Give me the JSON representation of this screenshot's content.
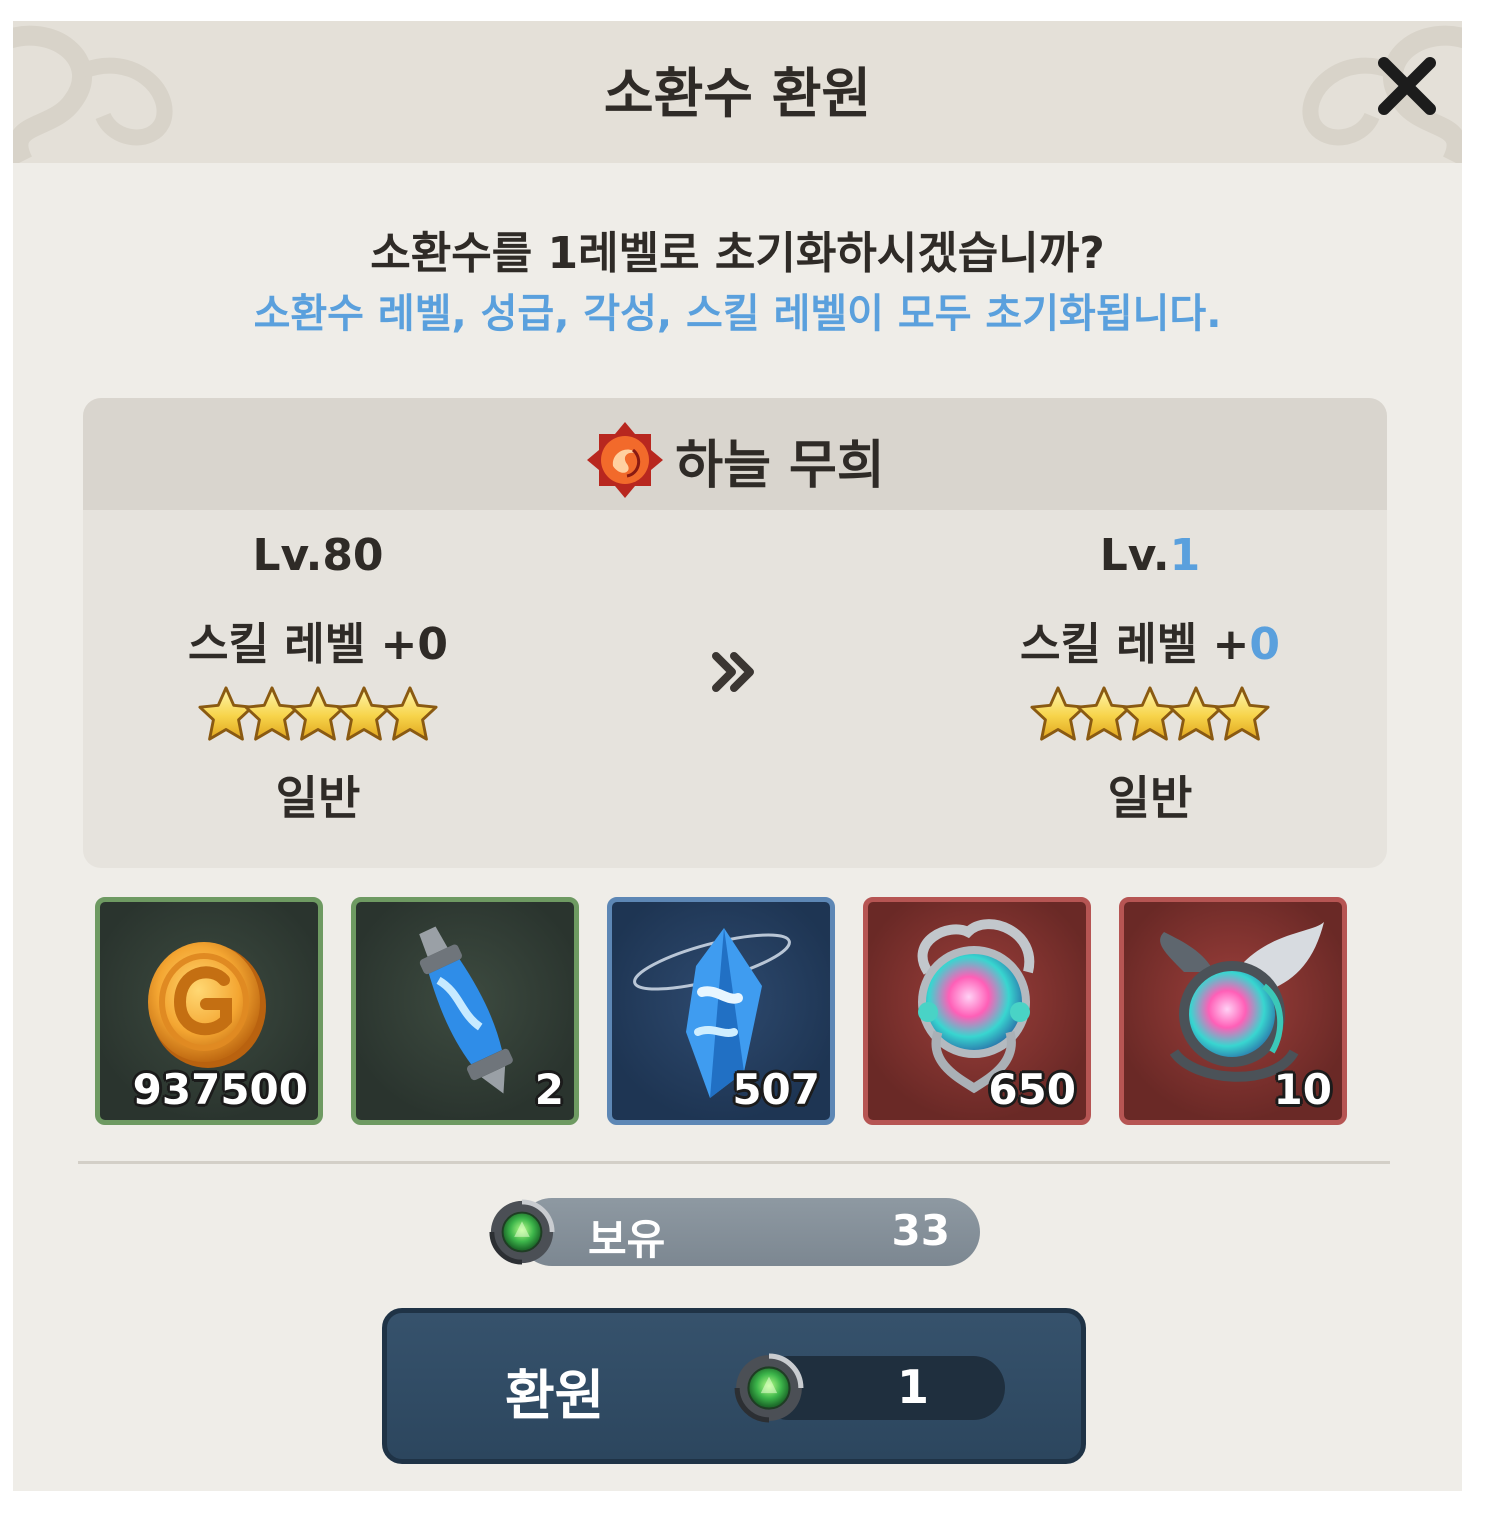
{
  "dialog": {
    "title": "소환수 환원",
    "question": "소환수를 1레벨로 초기화하시겠습니까?",
    "warning": "소환수 레벨, 성급, 각성, 스킬 레벨이 모두 초기화됩니다."
  },
  "summon": {
    "name": "하늘 무희",
    "element_icon": "fire-element-icon",
    "before": {
      "level_prefix": "Lv.",
      "level": "80",
      "skill_prefix": "스킬 레벨 +",
      "skill": "0",
      "stars": 5,
      "grade": "일반"
    },
    "after": {
      "level_prefix": "Lv.",
      "level": "1",
      "skill_prefix": "스킬 레벨 +",
      "skill": "0",
      "stars": 5,
      "grade": "일반"
    }
  },
  "rewards": [
    {
      "icon": "gold-coin-icon",
      "quantity": "937500",
      "rarity": "green"
    },
    {
      "icon": "blue-potion-vial-icon",
      "quantity": "2",
      "rarity": "green"
    },
    {
      "icon": "blue-crystal-icon",
      "quantity": "507",
      "rarity": "blue"
    },
    {
      "icon": "rainbow-orb-icon",
      "quantity": "650",
      "rarity": "red"
    },
    {
      "icon": "winged-orb-icon",
      "quantity": "10",
      "rarity": "red"
    }
  ],
  "owned": {
    "label": "보유",
    "value": "33",
    "icon": "green-gem-icon"
  },
  "confirm_button": {
    "label": "환원",
    "cost": "1",
    "icon": "green-gem-icon"
  },
  "colors": {
    "accent_blue": "#5aa0dd",
    "button": "#2f4a63",
    "background": "#efede8"
  }
}
